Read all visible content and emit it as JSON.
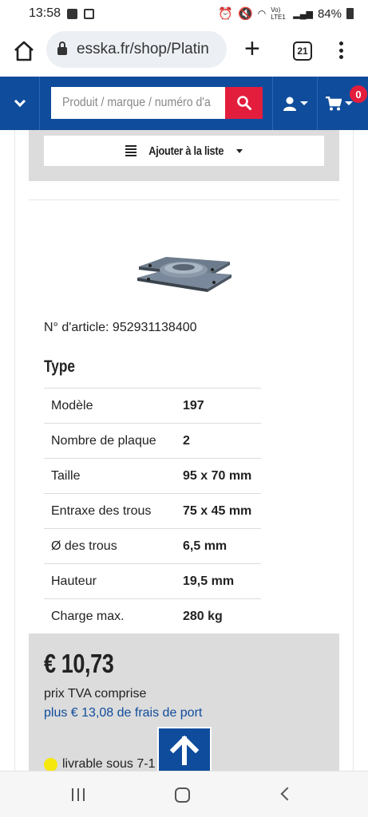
{
  "status_bar": {
    "time": "13:58",
    "battery": "84%",
    "network": "Vo) LTE1"
  },
  "browser": {
    "url": "esska.fr/shop/Platin",
    "tab_count": "21"
  },
  "site_nav": {
    "search_placeholder": "Produit / marque / numéro d'a",
    "cart_count": "0"
  },
  "product": {
    "wishlist_label": "Ajouter à la liste",
    "article_number": "N° d'article: 952931138400",
    "type_heading": "Type",
    "specs": [
      {
        "label": "Modèle",
        "value": "197"
      },
      {
        "label": "Nombre de plaque",
        "value": "2"
      },
      {
        "label": "Taille",
        "value": "95 x 70 mm"
      },
      {
        "label": "Entraxe des trous",
        "value": "75 x 45 mm"
      },
      {
        "label": "Ø des trous",
        "value": "6,5 mm"
      },
      {
        "label": "Hauteur",
        "value": "19,5 mm"
      },
      {
        "label": "Charge max.",
        "value": "280 kg"
      }
    ],
    "price": "€ 10,73",
    "vat_note": "prix TVA comprise",
    "shipping_note": "plus € 13,08 de frais de port",
    "availability": "livrable sous 7-1"
  },
  "colors": {
    "brand_blue": "#0f4c9c",
    "search_red": "#e31d3c",
    "availability_yellow": "#f5e80c"
  }
}
